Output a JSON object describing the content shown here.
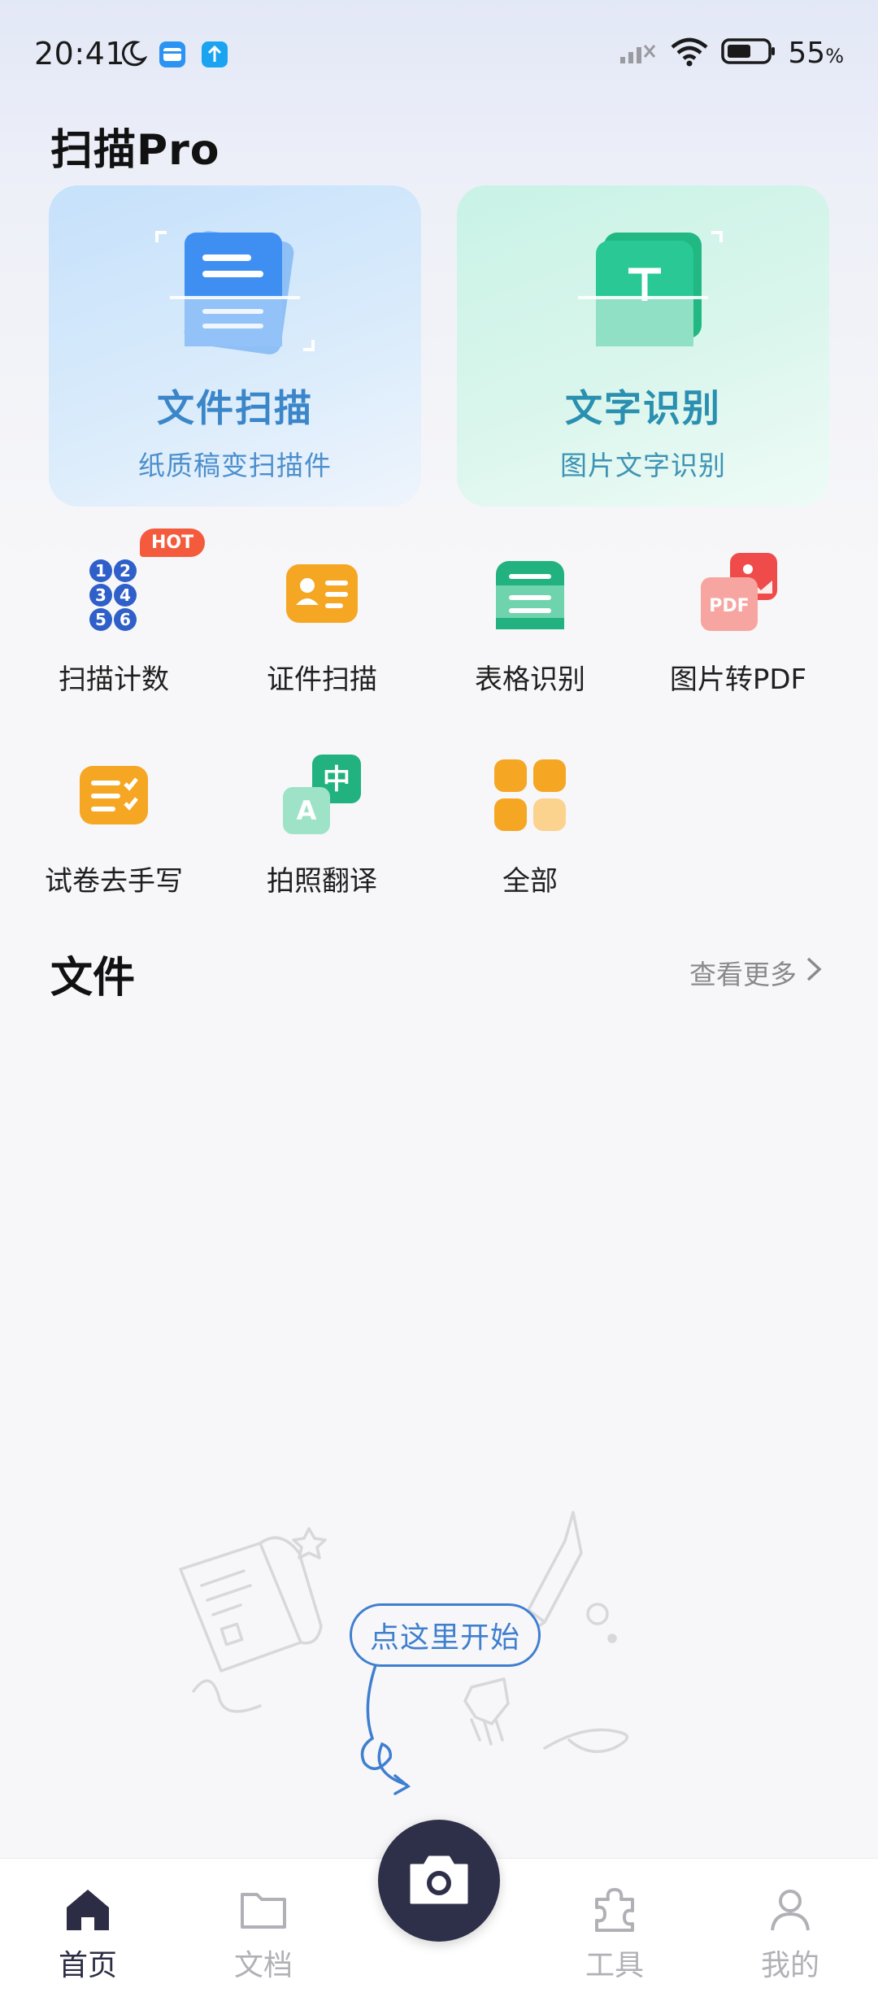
{
  "status": {
    "time": "20:41",
    "battery": "55",
    "battery_unit": "%"
  },
  "app_title": "扫描Pro",
  "hero": [
    {
      "title": "文件扫描",
      "subtitle": "纸质稿变扫描件"
    },
    {
      "title": "文字识别",
      "subtitle": "图片文字识别"
    }
  ],
  "tools": [
    {
      "label": "扫描计数",
      "icon": "number-count-icon"
    },
    {
      "label": "证件扫描",
      "icon": "id-card-icon"
    },
    {
      "label": "表格识别",
      "icon": "table-icon"
    },
    {
      "label": "图片转PDF",
      "icon": "image-to-pdf-icon"
    },
    {
      "label": "试卷去手写",
      "icon": "exam-paper-icon"
    },
    {
      "label": "拍照翻译",
      "icon": "translate-icon"
    },
    {
      "label": "全部",
      "icon": "all-apps-icon"
    }
  ],
  "hot_badge": "HOT",
  "files": {
    "title": "文件",
    "more": "查看更多"
  },
  "empty_state": {
    "hint": "点这里开始"
  },
  "tabbar": {
    "items": [
      {
        "label": "首页",
        "icon": "home-icon"
      },
      {
        "label": "文档",
        "icon": "folder-icon"
      },
      {
        "label": "工具",
        "icon": "puzzle-icon"
      },
      {
        "label": "我的",
        "icon": "user-icon"
      }
    ],
    "active": "首页"
  },
  "colors": {
    "accent_dark": "#2e2f48",
    "scan_blue": "#3a86c9",
    "ocr_green": "#21b884",
    "hot_red": "#f45a3c"
  }
}
